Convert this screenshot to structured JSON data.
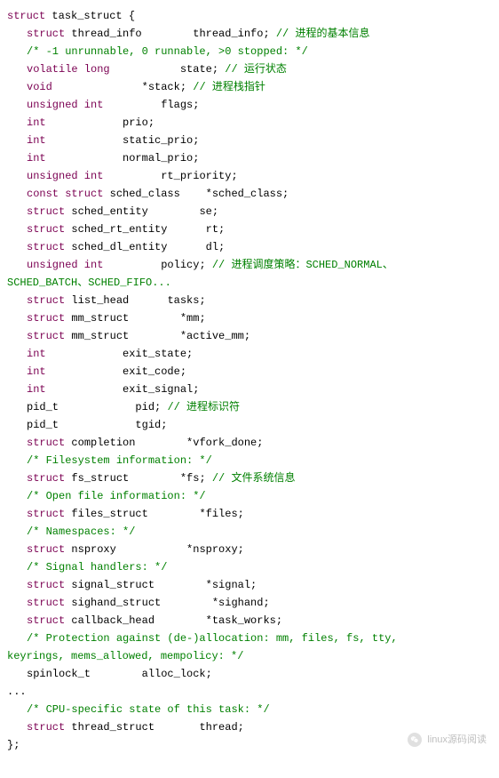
{
  "lines": [
    {
      "segs": [
        {
          "t": "struct",
          "c": "kw-struct"
        },
        {
          "t": " task_struct {",
          "c": "typename"
        }
      ],
      "indent": 0
    },
    {
      "segs": [
        {
          "t": "struct",
          "c": "kw-struct"
        },
        {
          "t": " thread_info        thread_info; ",
          "c": "typename"
        },
        {
          "t": "// 进程的基本信息",
          "c": "comment"
        }
      ],
      "indent": 1
    },
    {
      "segs": [
        {
          "t": "/* -1 unrunnable, 0 runnable, >0 stopped: */",
          "c": "comment"
        }
      ],
      "indent": 1
    },
    {
      "segs": [
        {
          "t": "volatile long",
          "c": "kw-type"
        },
        {
          "t": "           state; ",
          "c": "typename"
        },
        {
          "t": "// 运行状态",
          "c": "comment"
        }
      ],
      "indent": 1
    },
    {
      "segs": [
        {
          "t": "void",
          "c": "kw-type"
        },
        {
          "t": "              *stack; ",
          "c": "typename"
        },
        {
          "t": "// 进程栈指针",
          "c": "comment"
        }
      ],
      "indent": 1
    },
    {
      "segs": [
        {
          "t": "unsigned int",
          "c": "kw-type"
        },
        {
          "t": "         flags;",
          "c": "typename"
        }
      ],
      "indent": 1
    },
    {
      "segs": [
        {
          "t": "int",
          "c": "kw-type"
        },
        {
          "t": "            prio;",
          "c": "typename"
        }
      ],
      "indent": 1
    },
    {
      "segs": [
        {
          "t": "int",
          "c": "kw-type"
        },
        {
          "t": "            static_prio;",
          "c": "typename"
        }
      ],
      "indent": 1
    },
    {
      "segs": [
        {
          "t": "int",
          "c": "kw-type"
        },
        {
          "t": "            normal_prio;",
          "c": "typename"
        }
      ],
      "indent": 1
    },
    {
      "segs": [
        {
          "t": "unsigned int",
          "c": "kw-type"
        },
        {
          "t": "         rt_priority;",
          "c": "typename"
        }
      ],
      "indent": 1
    },
    {
      "segs": [
        {
          "t": "const struct",
          "c": "kw-const"
        },
        {
          "t": " sched_class    *sched_class;",
          "c": "typename"
        }
      ],
      "indent": 1
    },
    {
      "segs": [
        {
          "t": "struct",
          "c": "kw-struct"
        },
        {
          "t": " sched_entity        se;",
          "c": "typename"
        }
      ],
      "indent": 1
    },
    {
      "segs": [
        {
          "t": "struct",
          "c": "kw-struct"
        },
        {
          "t": " sched_rt_entity      rt;",
          "c": "typename"
        }
      ],
      "indent": 1
    },
    {
      "segs": [
        {
          "t": "struct",
          "c": "kw-struct"
        },
        {
          "t": " sched_dl_entity      dl;",
          "c": "typename"
        }
      ],
      "indent": 1
    },
    {
      "segs": [
        {
          "t": "unsigned int",
          "c": "kw-type"
        },
        {
          "t": "         policy; ",
          "c": "typename"
        },
        {
          "t": "// 进程调度策略：SCHED_NORMAL、",
          "c": "comment"
        }
      ],
      "indent": 1
    },
    {
      "segs": [
        {
          "t": "SCHED_BATCH、SCHED_FIFO...",
          "c": "macro"
        }
      ],
      "indent": 0
    },
    {
      "segs": [
        {
          "t": "struct",
          "c": "kw-struct"
        },
        {
          "t": " list_head      tasks;",
          "c": "typename"
        }
      ],
      "indent": 1
    },
    {
      "segs": [
        {
          "t": "struct",
          "c": "kw-struct"
        },
        {
          "t": " mm_struct        *mm;",
          "c": "typename"
        }
      ],
      "indent": 1
    },
    {
      "segs": [
        {
          "t": "struct",
          "c": "kw-struct"
        },
        {
          "t": " mm_struct        *active_mm;",
          "c": "typename"
        }
      ],
      "indent": 1
    },
    {
      "segs": [
        {
          "t": "int",
          "c": "kw-type"
        },
        {
          "t": "            exit_state;",
          "c": "typename"
        }
      ],
      "indent": 1
    },
    {
      "segs": [
        {
          "t": "int",
          "c": "kw-type"
        },
        {
          "t": "            exit_code;",
          "c": "typename"
        }
      ],
      "indent": 1
    },
    {
      "segs": [
        {
          "t": "int",
          "c": "kw-type"
        },
        {
          "t": "            exit_signal;",
          "c": "typename"
        }
      ],
      "indent": 1
    },
    {
      "segs": [
        {
          "t": "pid_t            pid; ",
          "c": "typename"
        },
        {
          "t": "// 进程标识符",
          "c": "comment"
        }
      ],
      "indent": 1
    },
    {
      "segs": [
        {
          "t": "pid_t            tgid;",
          "c": "typename"
        }
      ],
      "indent": 1
    },
    {
      "segs": [
        {
          "t": "struct",
          "c": "kw-struct"
        },
        {
          "t": " completion        *vfork_done;",
          "c": "typename"
        }
      ],
      "indent": 1
    },
    {
      "segs": [
        {
          "t": "/* Filesystem information: */",
          "c": "comment"
        }
      ],
      "indent": 1
    },
    {
      "segs": [
        {
          "t": "struct",
          "c": "kw-struct"
        },
        {
          "t": " fs_struct        *fs; ",
          "c": "typename"
        },
        {
          "t": "// 文件系统信息",
          "c": "comment"
        }
      ],
      "indent": 1
    },
    {
      "segs": [
        {
          "t": "/* Open file information: */",
          "c": "comment"
        }
      ],
      "indent": 1
    },
    {
      "segs": [
        {
          "t": "struct",
          "c": "kw-struct"
        },
        {
          "t": " files_struct        *files;",
          "c": "typename"
        }
      ],
      "indent": 1
    },
    {
      "segs": [
        {
          "t": "/* Namespaces: */",
          "c": "comment"
        }
      ],
      "indent": 1
    },
    {
      "segs": [
        {
          "t": "struct",
          "c": "kw-struct"
        },
        {
          "t": " nsproxy           *nsproxy;",
          "c": "typename"
        }
      ],
      "indent": 1
    },
    {
      "segs": [
        {
          "t": "/* Signal handlers: */",
          "c": "comment"
        }
      ],
      "indent": 1
    },
    {
      "segs": [
        {
          "t": "struct",
          "c": "kw-struct"
        },
        {
          "t": " signal_struct        *signal;",
          "c": "typename"
        }
      ],
      "indent": 1
    },
    {
      "segs": [
        {
          "t": "struct",
          "c": "kw-struct"
        },
        {
          "t": " sighand_struct        *sighand;",
          "c": "typename"
        }
      ],
      "indent": 1
    },
    {
      "segs": [
        {
          "t": "struct",
          "c": "kw-struct"
        },
        {
          "t": " callback_head        *task_works;",
          "c": "typename"
        }
      ],
      "indent": 1
    },
    {
      "segs": [
        {
          "t": "/* Protection against (de-)allocation: mm, files, fs, tty,",
          "c": "comment"
        }
      ],
      "indent": 1
    },
    {
      "segs": [
        {
          "t": "keyrings, mems_allowed, mempolicy: */",
          "c": "comment"
        }
      ],
      "indent": 0
    },
    {
      "segs": [
        {
          "t": "spinlock_t        alloc_lock;",
          "c": "typename"
        }
      ],
      "indent": 1
    },
    {
      "segs": [
        {
          "t": "...",
          "c": "typename"
        }
      ],
      "indent": 0
    },
    {
      "segs": [
        {
          "t": "/* CPU-specific state of this task: */",
          "c": "comment"
        }
      ],
      "indent": 1
    },
    {
      "segs": [
        {
          "t": "struct",
          "c": "kw-struct"
        },
        {
          "t": " thread_struct       thread;",
          "c": "typename"
        }
      ],
      "indent": 1
    },
    {
      "segs": [
        {
          "t": "};",
          "c": "typename"
        }
      ],
      "indent": 0
    }
  ],
  "watermark": "linux源码阅读"
}
